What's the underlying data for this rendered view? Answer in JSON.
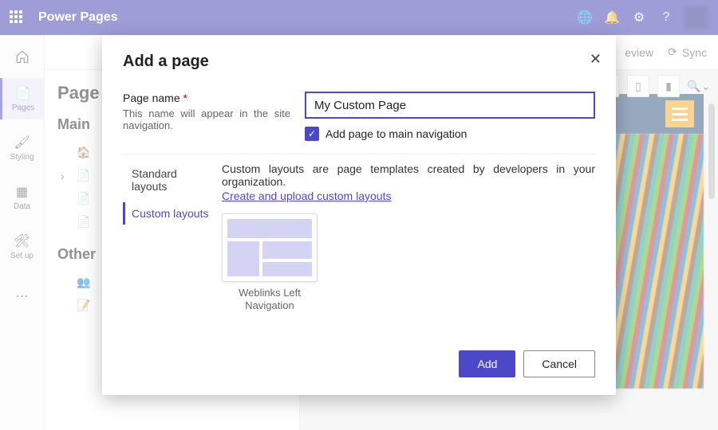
{
  "appbar": {
    "brand": "Power Pages"
  },
  "topright": {
    "preview_fragment": "eview",
    "sync": "Sync"
  },
  "leftnav": {
    "items": [
      {
        "label": "Pages"
      },
      {
        "label": "Styling"
      },
      {
        "label": "Data"
      },
      {
        "label": "Set up"
      }
    ]
  },
  "pagepanel": {
    "title_fragment": "Page",
    "section1_fragment": "Main",
    "section2_fragment": "Other"
  },
  "zoom": {
    "glyph": "🔍"
  },
  "dialog": {
    "title": "Add a page",
    "page_name_label": "Page name",
    "required_mark": "*",
    "page_name_hint": "This name will appear in the site navigation.",
    "page_name_value": "My Custom Page",
    "add_nav_label": "Add page to main navigation",
    "add_nav_checked": true,
    "tabs": {
      "standard": "Standard layouts",
      "custom": "Custom layouts"
    },
    "custom_desc": "Custom layouts are page templates created by developers in your organization.",
    "custom_link": "Create and upload custom layouts",
    "tile1_caption": "Weblinks Left Navigation",
    "add_btn": "Add",
    "cancel_btn": "Cancel"
  }
}
